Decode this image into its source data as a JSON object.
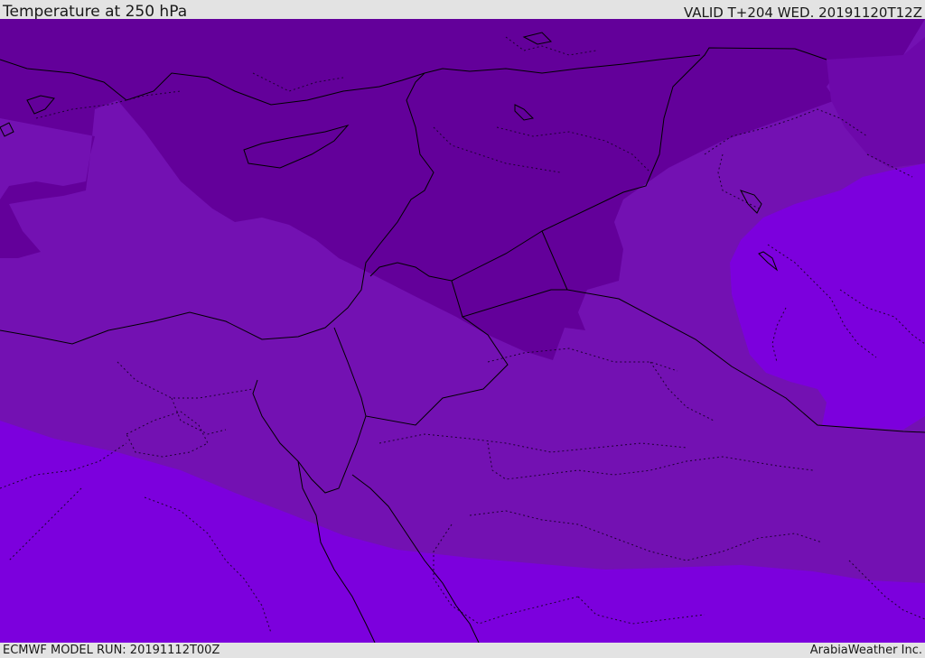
{
  "header": {
    "title": "Temperature at 250 hPa",
    "valid": "VALID T+204 WED. 20191120T12Z"
  },
  "footer": {
    "model_run": "ECMWF MODEL RUN: 20191112T00Z",
    "credit": "ArabiaWeather Inc."
  },
  "colors": {
    "darkest_band": "#63009a",
    "mid_band": "#7311b2",
    "light_band": "#7c00dd",
    "border_line": "#000000"
  }
}
